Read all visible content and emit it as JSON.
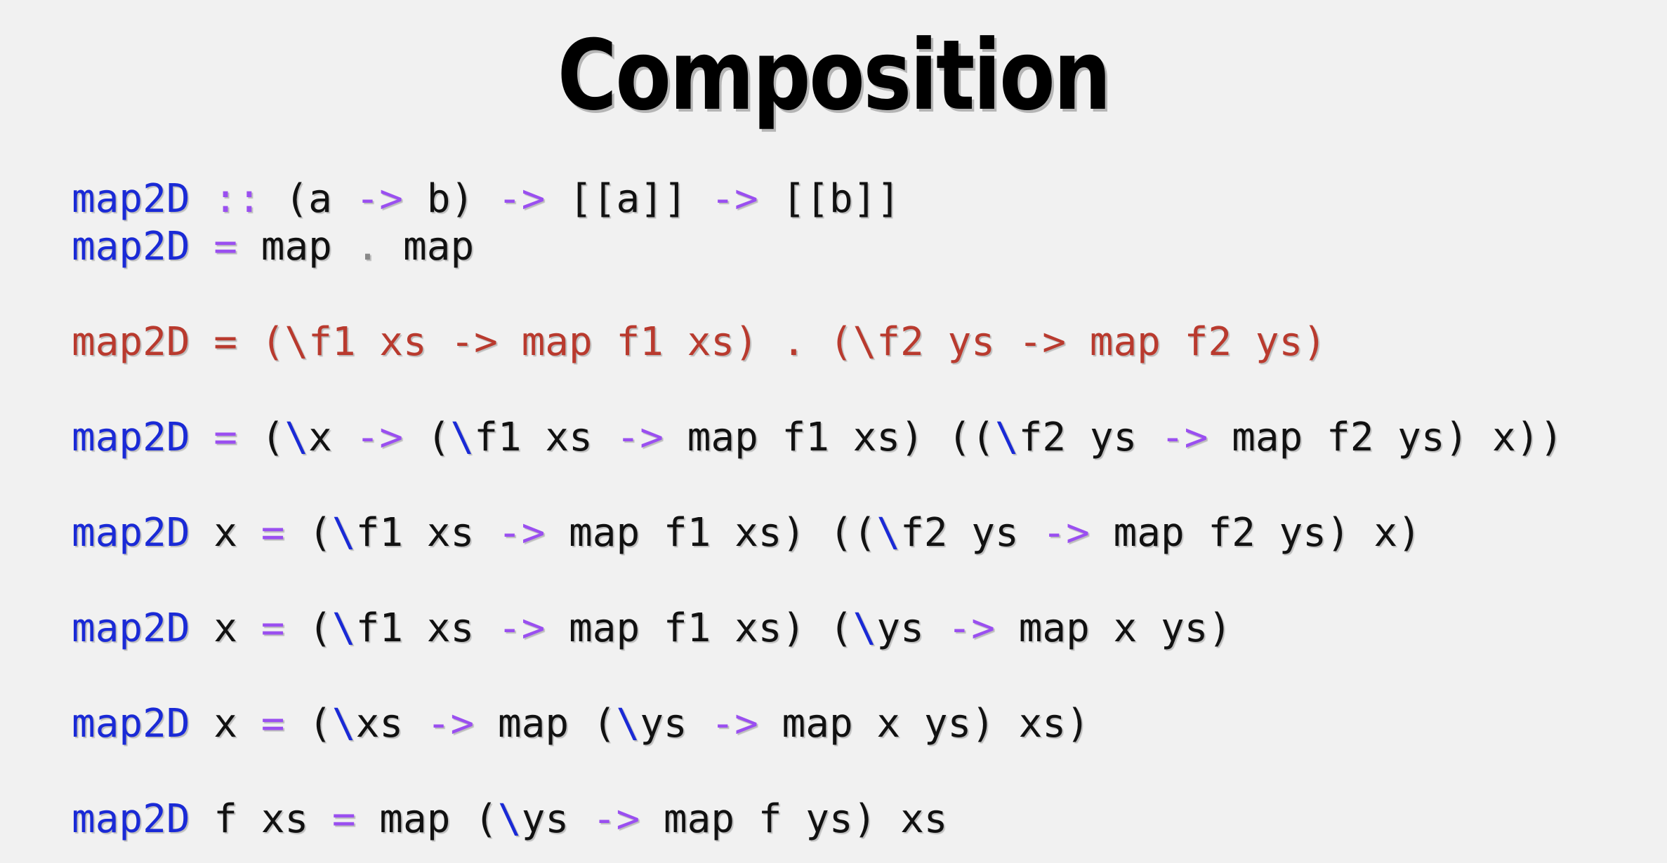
{
  "slide": {
    "title": "Composition"
  },
  "code": {
    "lines": [
      [
        {
          "t": "map2D",
          "c": "name"
        },
        {
          "t": " ",
          "c": "plain"
        },
        {
          "t": "::",
          "c": "op"
        },
        {
          "t": " (a ",
          "c": "plain"
        },
        {
          "t": "->",
          "c": "op"
        },
        {
          "t": " b) ",
          "c": "plain"
        },
        {
          "t": "->",
          "c": "op"
        },
        {
          "t": " [[a]] ",
          "c": "plain"
        },
        {
          "t": "->",
          "c": "op"
        },
        {
          "t": " [[b]]",
          "c": "plain"
        }
      ],
      [
        {
          "t": "map2D",
          "c": "name"
        },
        {
          "t": " ",
          "c": "plain"
        },
        {
          "t": "=",
          "c": "op"
        },
        {
          "t": " map ",
          "c": "plain"
        },
        {
          "t": ".",
          "c": "grey"
        },
        {
          "t": " map",
          "c": "plain"
        }
      ],
      null,
      [
        {
          "t": "map2D = (\\f1 xs -> map f1 xs) . (\\f2 ys -> map f2 ys)",
          "c": "red"
        }
      ],
      null,
      [
        {
          "t": "map2D",
          "c": "name"
        },
        {
          "t": " ",
          "c": "plain"
        },
        {
          "t": "=",
          "c": "op"
        },
        {
          "t": " (",
          "c": "plain"
        },
        {
          "t": "\\",
          "c": "name"
        },
        {
          "t": "x ",
          "c": "plain"
        },
        {
          "t": "->",
          "c": "op"
        },
        {
          "t": " (",
          "c": "plain"
        },
        {
          "t": "\\",
          "c": "name"
        },
        {
          "t": "f1 xs ",
          "c": "plain"
        },
        {
          "t": "->",
          "c": "op"
        },
        {
          "t": " map f1 xs) ((",
          "c": "plain"
        },
        {
          "t": "\\",
          "c": "name"
        },
        {
          "t": "f2 ys ",
          "c": "plain"
        },
        {
          "t": "->",
          "c": "op"
        },
        {
          "t": " map f2 ys) x))",
          "c": "plain"
        }
      ],
      null,
      [
        {
          "t": "map2D",
          "c": "name"
        },
        {
          "t": " x ",
          "c": "plain"
        },
        {
          "t": "=",
          "c": "op"
        },
        {
          "t": " (",
          "c": "plain"
        },
        {
          "t": "\\",
          "c": "name"
        },
        {
          "t": "f1 xs ",
          "c": "plain"
        },
        {
          "t": "->",
          "c": "op"
        },
        {
          "t": " map f1 xs) ((",
          "c": "plain"
        },
        {
          "t": "\\",
          "c": "name"
        },
        {
          "t": "f2 ys ",
          "c": "plain"
        },
        {
          "t": "->",
          "c": "op"
        },
        {
          "t": " map f2 ys) x)",
          "c": "plain"
        }
      ],
      null,
      [
        {
          "t": "map2D",
          "c": "name"
        },
        {
          "t": " x ",
          "c": "plain"
        },
        {
          "t": "=",
          "c": "op"
        },
        {
          "t": " (",
          "c": "plain"
        },
        {
          "t": "\\",
          "c": "name"
        },
        {
          "t": "f1 xs ",
          "c": "plain"
        },
        {
          "t": "->",
          "c": "op"
        },
        {
          "t": " map f1 xs) (",
          "c": "plain"
        },
        {
          "t": "\\",
          "c": "name"
        },
        {
          "t": "ys ",
          "c": "plain"
        },
        {
          "t": "->",
          "c": "op"
        },
        {
          "t": " map x ys)",
          "c": "plain"
        }
      ],
      null,
      [
        {
          "t": "map2D",
          "c": "name"
        },
        {
          "t": " x ",
          "c": "plain"
        },
        {
          "t": "=",
          "c": "op"
        },
        {
          "t": " (",
          "c": "plain"
        },
        {
          "t": "\\",
          "c": "name"
        },
        {
          "t": "xs ",
          "c": "plain"
        },
        {
          "t": "->",
          "c": "op"
        },
        {
          "t": " map (",
          "c": "plain"
        },
        {
          "t": "\\",
          "c": "name"
        },
        {
          "t": "ys ",
          "c": "plain"
        },
        {
          "t": "->",
          "c": "op"
        },
        {
          "t": " map x ys) xs)",
          "c": "plain"
        }
      ],
      null,
      [
        {
          "t": "map2D",
          "c": "name"
        },
        {
          "t": " f xs ",
          "c": "plain"
        },
        {
          "t": "=",
          "c": "op"
        },
        {
          "t": " map (",
          "c": "plain"
        },
        {
          "t": "\\",
          "c": "name"
        },
        {
          "t": "ys ",
          "c": "plain"
        },
        {
          "t": "->",
          "c": "op"
        },
        {
          "t": " map f ys) xs",
          "c": "plain"
        }
      ]
    ]
  },
  "colors": {
    "name": "#1a2ad6",
    "op": "#9a4ff0",
    "plain": "#111111",
    "red": "#b93a2e",
    "grey": "#888888",
    "background": "#f1f1f1"
  }
}
